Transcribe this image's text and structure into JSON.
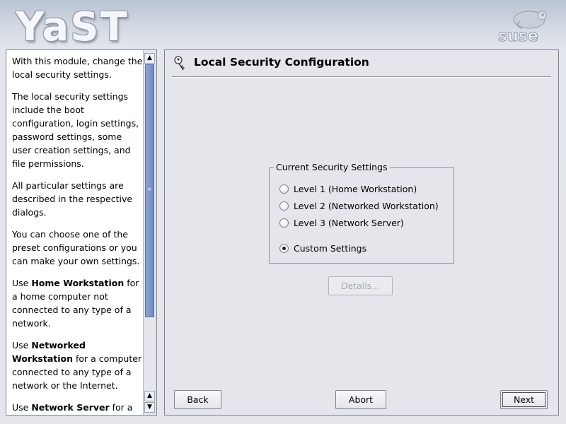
{
  "header": {
    "logo_text": "YaST",
    "brand_logo": "suse"
  },
  "help": {
    "paragraphs": [
      {
        "parts": [
          {
            "text": "With this module, change the local security settings."
          }
        ]
      },
      {
        "parts": [
          {
            "text": "The local security settings include the boot configuration, login settings, password settings, some user creation settings, and file permissions."
          }
        ]
      },
      {
        "parts": [
          {
            "text": "All particular settings are described in the respective dialogs."
          }
        ]
      },
      {
        "parts": [
          {
            "text": "You can choose one of the preset configurations or you can make your own settings."
          }
        ]
      },
      {
        "parts": [
          {
            "text": "Use "
          },
          {
            "text": "Home Workstation",
            "bold": true
          },
          {
            "text": " for a home computer not connected to any type of a network."
          }
        ]
      },
      {
        "parts": [
          {
            "text": "Use "
          },
          {
            "text": "Networked Workstation",
            "bold": true
          },
          {
            "text": " for a computer connected to any type of a network or the Internet."
          }
        ]
      },
      {
        "parts": [
          {
            "text": "Use "
          },
          {
            "text": "Network Server",
            "bold": true
          },
          {
            "text": " for a"
          }
        ]
      }
    ]
  },
  "main": {
    "title": "Local Security Configuration",
    "group_title": "Current Security Settings",
    "options": [
      {
        "label": "Level 1 (Home Workstation)",
        "checked": false
      },
      {
        "label": "Level 2 (Networked Workstation)",
        "checked": false
      },
      {
        "label": "Level 3 (Network Server)",
        "checked": false
      },
      {
        "label": "Custom Settings",
        "checked": true
      }
    ],
    "details_label": "Details...",
    "details_enabled": false
  },
  "buttons": {
    "back": "Back",
    "abort": "Abort",
    "next": "Next"
  },
  "colors": {
    "panel_bg": "#e4e6ec",
    "scroll_thumb": "#7b93c6",
    "border": "#7d8391"
  }
}
